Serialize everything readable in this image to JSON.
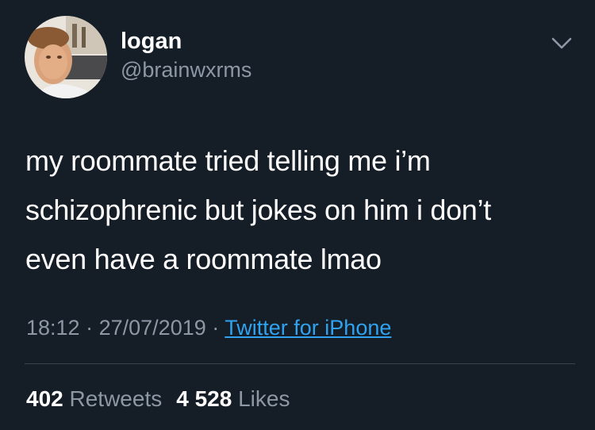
{
  "user": {
    "display_name": "logan",
    "handle": "@brainwxrms"
  },
  "tweet": {
    "text": "my roommate tried telling me i’m\nschizophrenic but jokes on him i don’t\neven have a roommate lmao",
    "time": "18:12",
    "separator": "·",
    "date": "27/07/2019",
    "source": "Twitter for iPhone"
  },
  "stats": {
    "retweets_count": "402",
    "retweets_label": "Retweets",
    "likes_count": "4 528",
    "likes_label": "Likes"
  },
  "colors": {
    "background": "#151d27",
    "secondary_text": "#8d98a5",
    "link": "#2fa3ef",
    "divider": "#38444d"
  },
  "icons": {
    "menu": "chevron-down-icon"
  }
}
